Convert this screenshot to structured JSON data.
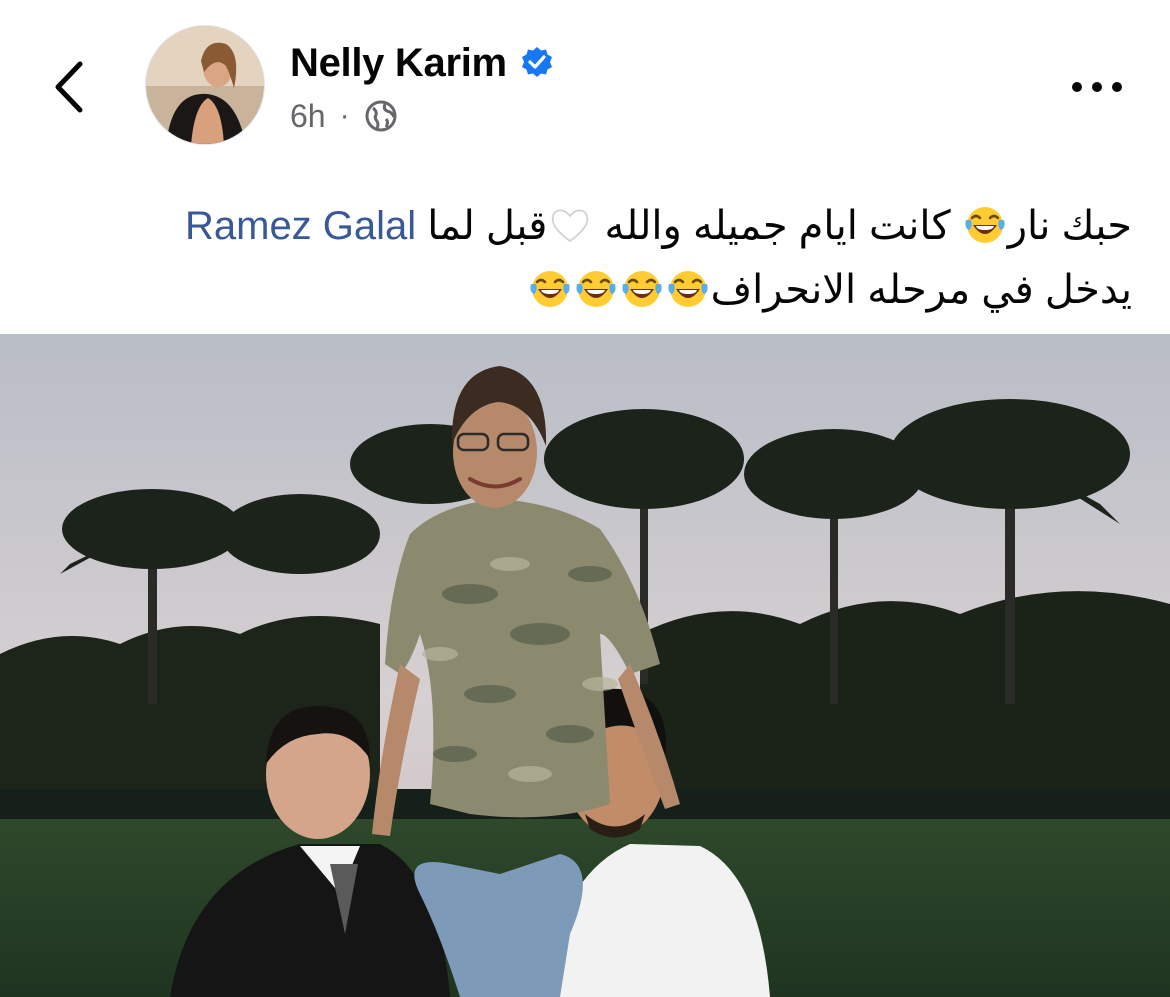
{
  "header": {
    "author_name": "Nelly Karim",
    "time": "6h",
    "separator": "·",
    "icons": {
      "back": "chevron-left-icon",
      "verified": "verified-badge-icon",
      "audience": "globe-icon",
      "more": "more-dots-icon"
    },
    "colors": {
      "verified": "#1877f2",
      "meta": "#65676b",
      "mention": "#385898"
    }
  },
  "post": {
    "line1_part1": "حبك نار",
    "line1_part2": " كانت ايام جميله والله ",
    "line1_part3": "قبل لما ",
    "mention": "Ramez Galal",
    "line2_text": "يدخل في مرحله الانحراف",
    "emoji": {
      "laugh": "tears-of-joy-emoji",
      "heart": "white-heart-emoji"
    }
  }
}
